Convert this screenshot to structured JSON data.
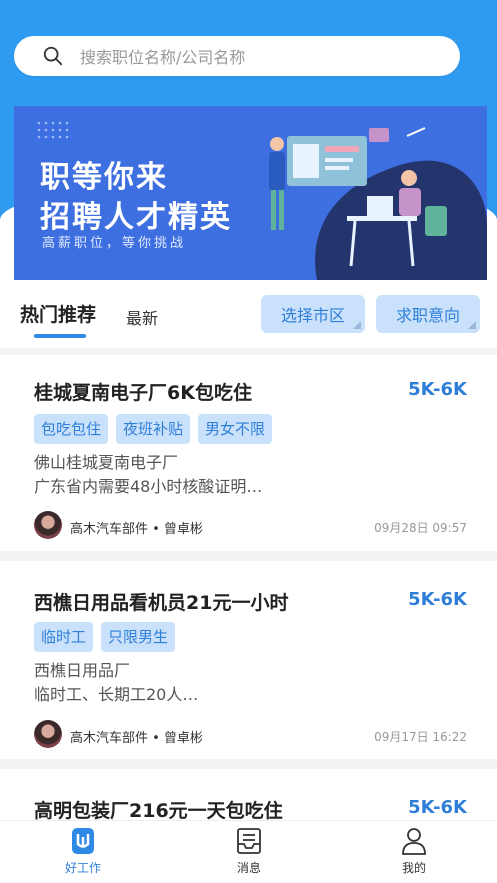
{
  "search": {
    "placeholder": "搜索职位名称/公司名称",
    "icon": "search-icon"
  },
  "banner": {
    "line1": "职等你来",
    "line2": "招聘人才精英",
    "line3": "高薪职位，等你挑战"
  },
  "tabs": {
    "hot": "热门推荐",
    "latest": "最新"
  },
  "filters": {
    "region": "选择市区",
    "intent": "求职意向"
  },
  "jobs": [
    {
      "title": "桂城夏南电子厂6K包吃住",
      "salary": "5K-6K",
      "tags": [
        "包吃包住",
        "夜班补贴",
        "男女不限"
      ],
      "desc1": "佛山桂城夏南电子厂",
      "desc2": "广东省内需要48小时核酸证明…",
      "company": "高木汽车部件 • 曾卓彬",
      "date": "09月28日 09:57"
    },
    {
      "title": "西樵日用品看机员21元一小时",
      "salary": "5K-6K",
      "tags": [
        "临时工",
        "只限男生"
      ],
      "desc1": "西樵日用品厂",
      "desc2": "临时工、长期工20人…",
      "company": "高木汽车部件 • 曾卓彬",
      "date": "09月17日 16:22"
    },
    {
      "title": "高明包装厂216元一天包吃住",
      "salary": "5K-6K"
    }
  ],
  "nav": {
    "work": "好工作",
    "messages": "消息",
    "mine": "我的"
  },
  "colors": {
    "primary": "#2f9bf0",
    "accent": "#2f7fd8",
    "tag_bg": "#c9e1fb"
  }
}
